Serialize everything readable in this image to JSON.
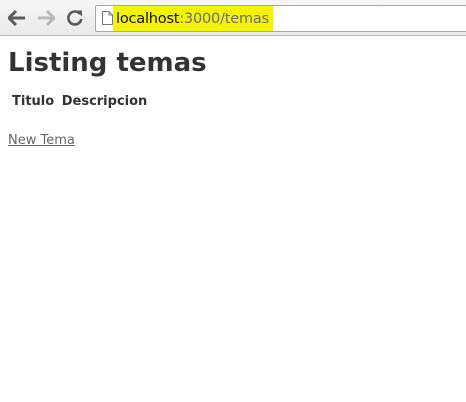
{
  "browser": {
    "url_host": "localhost",
    "url_rest": ":3000/temas",
    "highlight_color": "#f6f300",
    "icons": {
      "back": "back-arrow-icon",
      "forward": "forward-arrow-icon",
      "reload": "reload-icon",
      "page": "page-icon"
    }
  },
  "page": {
    "title": "Listing temas",
    "table": {
      "headers": [
        "Titulo",
        "Descripcion"
      ],
      "rows": []
    },
    "new_link": "New Tema"
  }
}
